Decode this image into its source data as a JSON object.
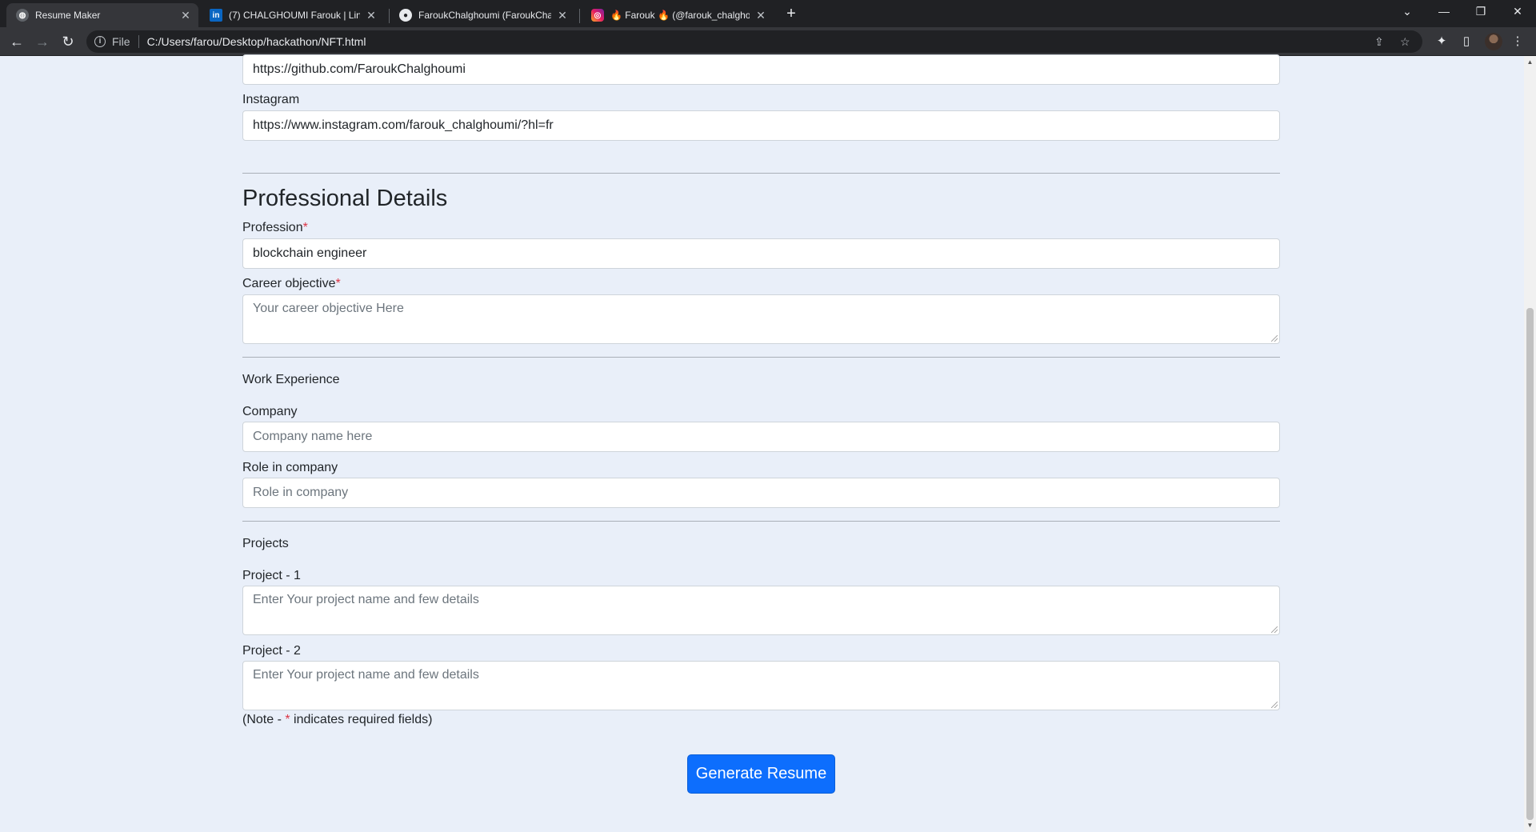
{
  "browser": {
    "tabs": [
      {
        "title": "Resume Maker",
        "icon": "globe-icon",
        "active": true
      },
      {
        "title": "(7) CHALGHOUMI Farouk | LinkedIn",
        "icon": "linkedin-icon",
        "active": false
      },
      {
        "title": "FaroukChalghoumi (FaroukChalghoumi)",
        "icon": "github-icon",
        "active": false
      },
      {
        "title": "🔥 Farouk 🔥 (@farouk_chalghoumi)",
        "icon": "instagram-icon",
        "active": false
      }
    ],
    "address": {
      "scheme": "File",
      "url": "C:/Users/farou/Desktop/hackathon/NFT.html"
    }
  },
  "form": {
    "github_value": "https://github.com/FaroukChalghoumi",
    "instagram_label": "Instagram",
    "instagram_value": "https://www.instagram.com/farouk_chalghoumi/?hl=fr",
    "professional_heading": "Professional Details",
    "profession_label": "Profession",
    "profession_value": "blockchain engineer",
    "career_label": "Career objective",
    "career_placeholder": "Your career objective Here",
    "work_heading": "Work Experience",
    "company_label": "Company",
    "company_placeholder": "Company name here",
    "role_label": "Role in company",
    "role_placeholder": "Role in company",
    "projects_heading": "Projects",
    "project1_label": "Project - 1",
    "project1_placeholder": "Enter Your project name and few details",
    "project2_label": "Project - 2",
    "project2_placeholder": "Enter Your project name and few details",
    "note_prefix": "(Note - ",
    "required_mark": "*",
    "note_suffix": " indicates required fields)",
    "submit_label": "Generate Resume"
  },
  "colors": {
    "page_bg": "#e9eff9",
    "primary": "#0d6efd",
    "required": "#dc3545"
  }
}
